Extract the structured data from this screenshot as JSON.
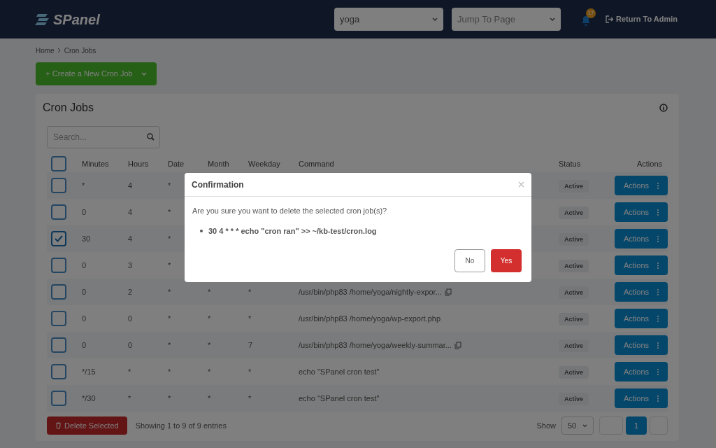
{
  "header": {
    "logo": "SPanel",
    "account_select": {
      "value": "yoga"
    },
    "page_select": {
      "placeholder": "Jump To Page"
    },
    "notifications": {
      "count": "17"
    },
    "return_link": "Return To Admin"
  },
  "breadcrumb": [
    "Home",
    "Cron Jobs"
  ],
  "create_button": "+ Create a New Cron Job",
  "card": {
    "title": "Cron Jobs",
    "search": {
      "placeholder": "Search..."
    },
    "table": {
      "select_all_checked": false,
      "columns": [
        "Minutes",
        "Hours",
        "Date",
        "Month",
        "Weekday",
        "Command",
        "Status",
        "Actions"
      ],
      "rows": [
        {
          "checked": false,
          "minutes": "*",
          "hours": "4",
          "date": "*",
          "status": "Active",
          "action": "Actions"
        },
        {
          "checked": false,
          "minutes": "0",
          "hours": "4",
          "date": "*",
          "status": "Active",
          "action": "Actions"
        },
        {
          "checked": true,
          "minutes": "30",
          "hours": "4",
          "date": "*",
          "status": "Active",
          "action": "Actions"
        },
        {
          "checked": false,
          "minutes": "0",
          "hours": "3",
          "date": "*",
          "status": "Active",
          "action": "Actions"
        },
        {
          "checked": false,
          "minutes": "0",
          "hours": "2",
          "date": "*",
          "month": "*",
          "weekday": "*",
          "command": "/usr/bin/php83 /home/yoga/nightly-expor...",
          "copy_icon": true,
          "status": "Active",
          "action": "Actions"
        },
        {
          "checked": false,
          "minutes": "0",
          "hours": "0",
          "date": "*",
          "month": "*",
          "weekday": "*",
          "command": "/usr/bin/php83 /home/yoga/wp-export.php",
          "copy_icon": false,
          "status": "Active",
          "action": "Actions"
        },
        {
          "checked": false,
          "minutes": "0",
          "hours": "0",
          "date": "*",
          "month": "*",
          "weekday": "7",
          "command": "/usr/bin/php83 /home/yoga/weekly-summar...",
          "copy_icon": true,
          "status": "Active",
          "action": "Actions"
        },
        {
          "checked": false,
          "minutes": "*/15",
          "hours": "*",
          "date": "*",
          "month": "*",
          "weekday": "*",
          "command": "echo \"SPanel cron test\"",
          "copy_icon": false,
          "status": "Active",
          "action": "Actions"
        },
        {
          "checked": false,
          "minutes": "*/30",
          "hours": "*",
          "date": "*",
          "month": "*",
          "weekday": "*",
          "command": "echo \"SPanel cron test\"",
          "copy_icon": false,
          "status": "Active",
          "action": "Actions"
        }
      ]
    },
    "footer": {
      "delete_button": "Delete Selected",
      "summary": "Showing 1 to 9 of 9 entries",
      "show_label": "Show",
      "page_size": "50",
      "pages": [
        {
          "label": "1",
          "selected": true
        }
      ]
    }
  },
  "dialog": {
    "title": "Confirmation",
    "message": "Are you sure you want to delete the selected cron job(s)?",
    "items": [
      "30 4 * * * echo \"cron ran\" >> ~/kb-test/cron.log"
    ],
    "buttons": [
      {
        "label": "No",
        "kind": "secondary"
      },
      {
        "label": "Yes",
        "kind": "danger"
      }
    ]
  }
}
